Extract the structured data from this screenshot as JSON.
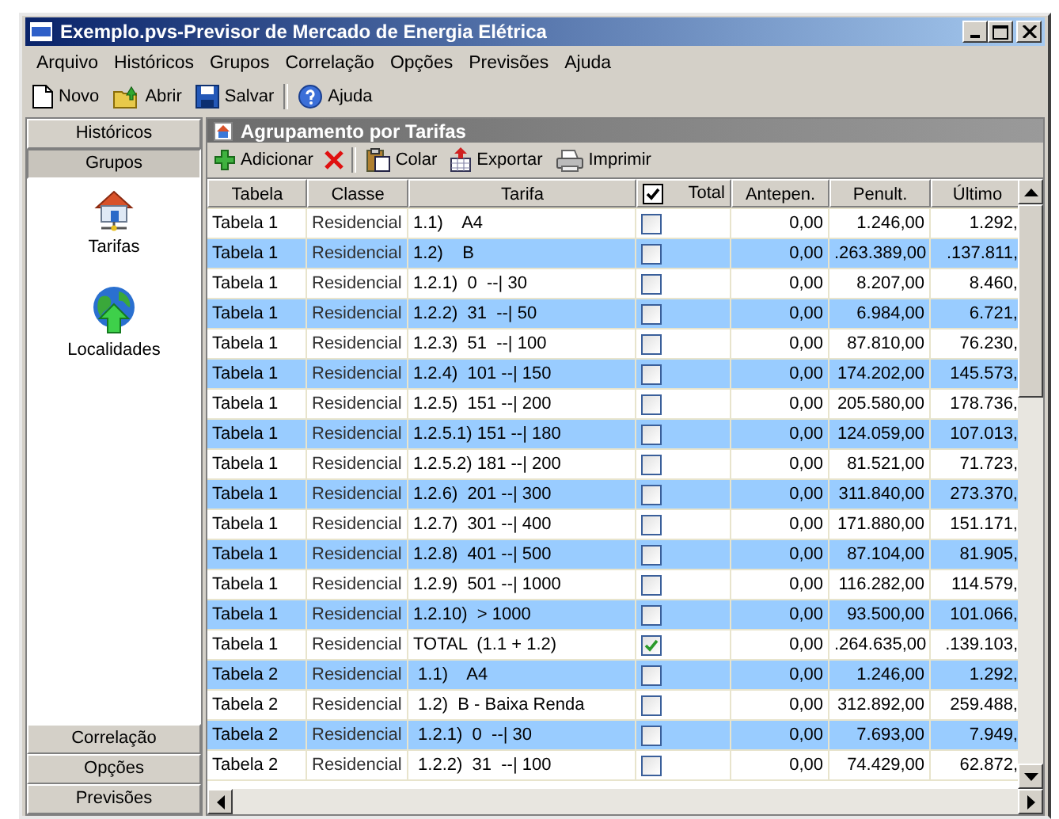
{
  "window": {
    "title": "Exemplo.pvs-Previsor de Mercado de Energia Elétrica"
  },
  "menu": [
    "Arquivo",
    "Históricos",
    "Grupos",
    "Correlação",
    "Opções",
    "Previsões",
    "Ajuda"
  ],
  "toolbar": [
    {
      "kind": "new",
      "label": "Novo"
    },
    {
      "kind": "open",
      "label": "Abrir"
    },
    {
      "kind": "save",
      "label": "Salvar"
    },
    {
      "kind": "sep"
    },
    {
      "kind": "help",
      "label": "Ajuda"
    }
  ],
  "sidebar": {
    "top_sections": [
      {
        "label": "Históricos",
        "selected": false
      },
      {
        "label": "Grupos",
        "selected": true
      }
    ],
    "items": [
      {
        "kind": "house",
        "label": "Tarifas"
      },
      {
        "kind": "globe",
        "label": "Localidades"
      }
    ],
    "bottom_sections": [
      {
        "label": "Correlação",
        "selected": false
      },
      {
        "label": "Opções",
        "selected": false
      },
      {
        "label": "Previsões",
        "selected": false
      }
    ]
  },
  "panel": {
    "title": "Agrupamento por Tarifas",
    "actions": [
      {
        "kind": "add",
        "label": "Adicionar"
      },
      {
        "kind": "delete"
      },
      {
        "kind": "sep"
      },
      {
        "kind": "paste",
        "label": "Colar"
      },
      {
        "kind": "export",
        "label": "Exportar"
      },
      {
        "kind": "print",
        "label": "Imprimir"
      }
    ]
  },
  "table": {
    "columns": [
      "Tabela",
      "Classe",
      "Tarifa",
      "Total",
      "Antepen.",
      "Penult.",
      "Último"
    ],
    "header_check": true,
    "rows": [
      {
        "tabela": "Tabela 1",
        "classe": "Residencial",
        "tarifa": "1.1)    A4",
        "total": false,
        "antepen": "0,00",
        "penult": "1.246,00",
        "ultimo": "1.292,"
      },
      {
        "tabela": "Tabela 1",
        "classe": "Residencial",
        "tarifa": "1.2)    B",
        "total": false,
        "antepen": "0,00",
        "penult": ".263.389,00",
        "ultimo": ".137.811,"
      },
      {
        "tabela": "Tabela 1",
        "classe": "Residencial",
        "tarifa": "1.2.1)  0  --| 30",
        "total": false,
        "antepen": "0,00",
        "penult": "8.207,00",
        "ultimo": "8.460,"
      },
      {
        "tabela": "Tabela 1",
        "classe": "Residencial",
        "tarifa": "1.2.2)  31  --| 50",
        "total": false,
        "antepen": "0,00",
        "penult": "6.984,00",
        "ultimo": "6.721,"
      },
      {
        "tabela": "Tabela 1",
        "classe": "Residencial",
        "tarifa": "1.2.3)  51  --| 100",
        "total": false,
        "antepen": "0,00",
        "penult": "87.810,00",
        "ultimo": "76.230,"
      },
      {
        "tabela": "Tabela 1",
        "classe": "Residencial",
        "tarifa": "1.2.4)  101 --| 150",
        "total": false,
        "antepen": "0,00",
        "penult": "174.202,00",
        "ultimo": "145.573,"
      },
      {
        "tabela": "Tabela 1",
        "classe": "Residencial",
        "tarifa": "1.2.5)  151 --| 200",
        "total": false,
        "antepen": "0,00",
        "penult": "205.580,00",
        "ultimo": "178.736,"
      },
      {
        "tabela": "Tabela 1",
        "classe": "Residencial",
        "tarifa": "1.2.5.1) 151 --| 180",
        "total": false,
        "antepen": "0,00",
        "penult": "124.059,00",
        "ultimo": "107.013,"
      },
      {
        "tabela": "Tabela 1",
        "classe": "Residencial",
        "tarifa": "1.2.5.2) 181 --| 200",
        "total": false,
        "antepen": "0,00",
        "penult": "81.521,00",
        "ultimo": "71.723,"
      },
      {
        "tabela": "Tabela 1",
        "classe": "Residencial",
        "tarifa": "1.2.6)  201 --| 300",
        "total": false,
        "antepen": "0,00",
        "penult": "311.840,00",
        "ultimo": "273.370,"
      },
      {
        "tabela": "Tabela 1",
        "classe": "Residencial",
        "tarifa": "1.2.7)  301 --| 400",
        "total": false,
        "antepen": "0,00",
        "penult": "171.880,00",
        "ultimo": "151.171,"
      },
      {
        "tabela": "Tabela 1",
        "classe": "Residencial",
        "tarifa": "1.2.8)  401 --| 500",
        "total": false,
        "antepen": "0,00",
        "penult": "87.104,00",
        "ultimo": "81.905,"
      },
      {
        "tabela": "Tabela 1",
        "classe": "Residencial",
        "tarifa": "1.2.9)  501 --| 1000",
        "total": false,
        "antepen": "0,00",
        "penult": "116.282,00",
        "ultimo": "114.579,"
      },
      {
        "tabela": "Tabela 1",
        "classe": "Residencial",
        "tarifa": "1.2.10)  > 1000",
        "total": false,
        "antepen": "0,00",
        "penult": "93.500,00",
        "ultimo": "101.066,"
      },
      {
        "tabela": "Tabela 1",
        "classe": "Residencial",
        "tarifa": "TOTAL  (1.1 + 1.2)",
        "total": true,
        "antepen": "0,00",
        "penult": ".264.635,00",
        "ultimo": ".139.103,"
      },
      {
        "tabela": "Tabela 2",
        "classe": "Residencial",
        "tarifa": " 1.1)    A4",
        "total": false,
        "antepen": "0,00",
        "penult": "1.246,00",
        "ultimo": "1.292,"
      },
      {
        "tabela": "Tabela 2",
        "classe": "Residencial",
        "tarifa": " 1.2)  B - Baixa Renda",
        "total": false,
        "antepen": "0,00",
        "penult": "312.892,00",
        "ultimo": "259.488,"
      },
      {
        "tabela": "Tabela 2",
        "classe": "Residencial",
        "tarifa": " 1.2.1)  0  --| 30",
        "total": false,
        "antepen": "0,00",
        "penult": "7.693,00",
        "ultimo": "7.949,"
      },
      {
        "tabela": "Tabela 2",
        "classe": "Residencial",
        "tarifa": " 1.2.2)  31  --| 100",
        "total": false,
        "antepen": "0,00",
        "penult": "74.429,00",
        "ultimo": "62.872,"
      }
    ]
  }
}
